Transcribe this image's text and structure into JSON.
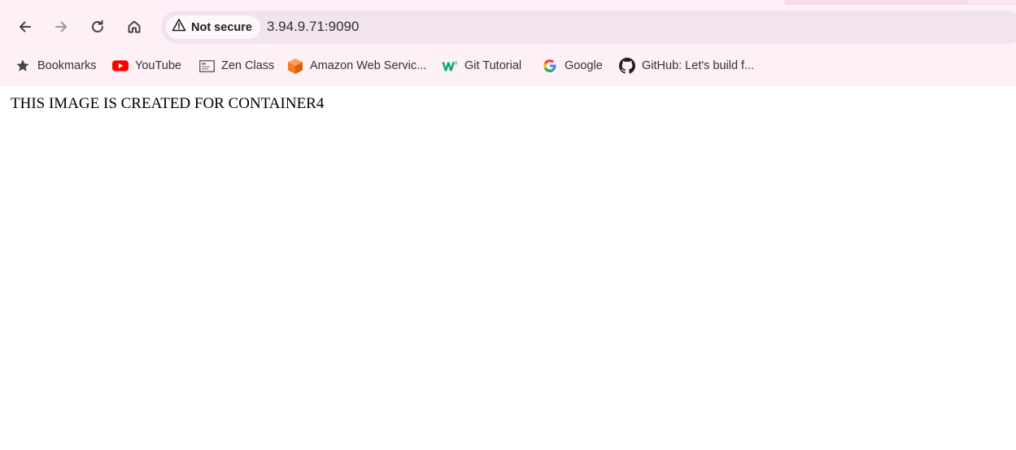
{
  "toolbar": {
    "back_icon": "arrow-left-icon",
    "forward_icon": "arrow-right-icon",
    "reload_icon": "reload-icon",
    "home_icon": "home-icon"
  },
  "omnibox": {
    "security_label": "Not secure",
    "url": "3.94.9.71:9090",
    "warning_icon": "warning-triangle-icon"
  },
  "bookmarks": [
    {
      "label": "Bookmarks",
      "icon": "star-icon"
    },
    {
      "label": "YouTube",
      "icon": "youtube-icon"
    },
    {
      "label": "Zen Class",
      "icon": "zen-class-icon"
    },
    {
      "label": "Amazon Web Servic...",
      "icon": "aws-cube-icon"
    },
    {
      "label": "Git Tutorial",
      "icon": "w3schools-icon"
    },
    {
      "label": "Google",
      "icon": "google-icon"
    },
    {
      "label": "GitHub: Let's build f...",
      "icon": "github-icon"
    }
  ],
  "page": {
    "body_text": "THIS IMAGE IS CREATED FOR CONTAINER4"
  },
  "colors": {
    "chrome_bg": "#fdf0f6",
    "omnibox_bg": "#f1e4ee",
    "youtube_red": "#ff0000",
    "aws_orange": "#f57c20",
    "w3_green": "#04aa6d"
  }
}
